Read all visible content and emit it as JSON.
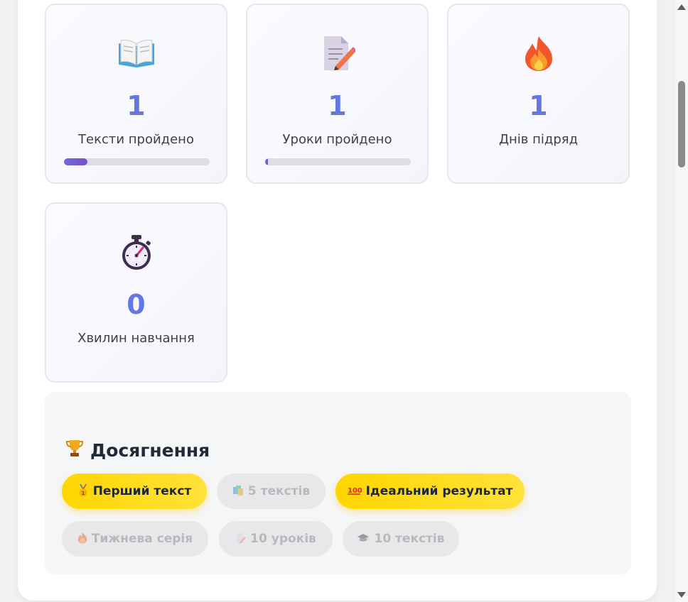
{
  "stats": [
    {
      "icon": "open-book-icon",
      "value": "1",
      "label": "Тексти пройдено",
      "progress": 0.16
    },
    {
      "icon": "memo-pencil-icon",
      "value": "1",
      "label": "Уроки пройдено",
      "progress": 0.02
    },
    {
      "icon": "fire-icon",
      "value": "1",
      "label": "Днів підряд"
    },
    {
      "icon": "stopwatch-icon",
      "value": "0",
      "label": "Хвилин навчання"
    }
  ],
  "achievements": {
    "title": "Досягнення",
    "title_icon": "trophy-icon",
    "badges": [
      {
        "label": "Перший текст",
        "icon": "medal-icon",
        "earned": true
      },
      {
        "label": "5 текстів",
        "icon": "books-icon",
        "earned": false
      },
      {
        "label": "Ідеальний результат",
        "icon": "hundred-points-icon",
        "earned": true
      },
      {
        "label": "Тижнева серія",
        "icon": "fire-icon",
        "earned": false
      },
      {
        "label": "10 уроків",
        "icon": "memo-pencil-icon",
        "earned": false
      },
      {
        "label": "10 текстів",
        "icon": "graduation-cap-icon",
        "earned": false
      }
    ]
  },
  "colors": {
    "accent": "#6277e3",
    "badge_earned": "#ffd600",
    "badge_locked": "#e8e8ea"
  }
}
